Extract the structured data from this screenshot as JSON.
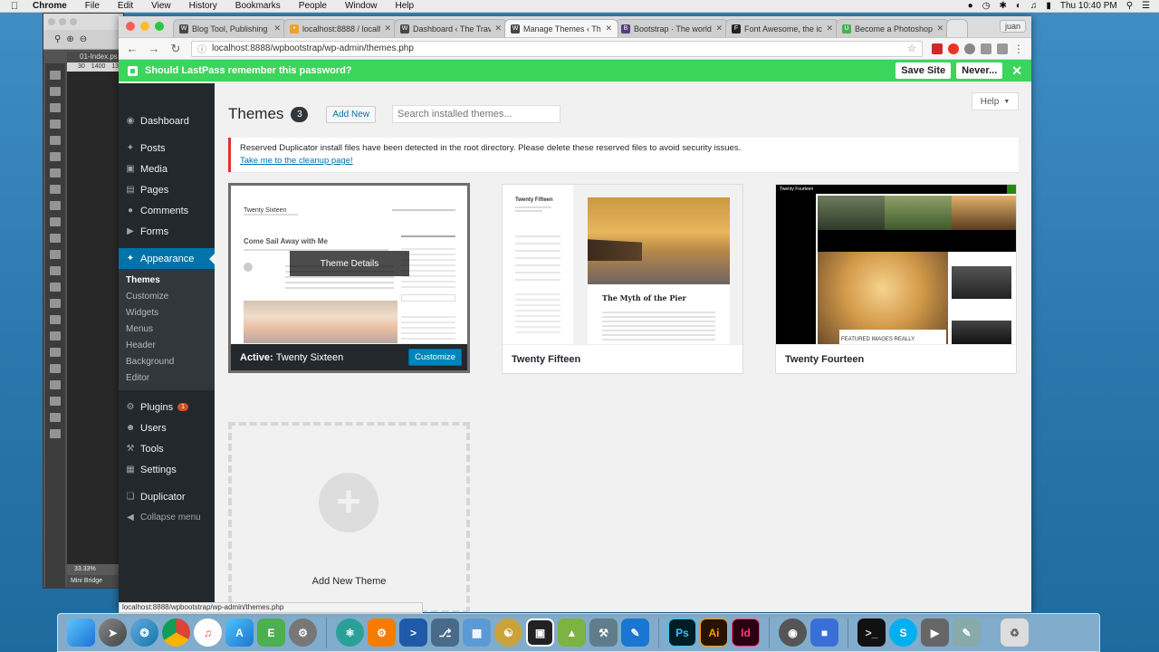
{
  "menubar": {
    "items": [
      "Chrome",
      "File",
      "Edit",
      "View",
      "History",
      "Bookmarks",
      "People",
      "Window",
      "Help"
    ],
    "clock": "Thu 10:40 PM"
  },
  "photoshop": {
    "doc_tab": "01-Index.ps",
    "ruler": [
      "30",
      "1400",
      "13"
    ],
    "zoom": "33.33%",
    "bridge": "Mini Bridge"
  },
  "browser": {
    "tabs": [
      {
        "title": "Blog Tool, Publishing Pl",
        "color": "#464646",
        "icon": "W"
      },
      {
        "title": "localhost:8888 / localhc",
        "color": "#f0a030",
        "icon": "•"
      },
      {
        "title": "Dashboard ‹ The Travel",
        "color": "#464646",
        "icon": "W"
      },
      {
        "title": "Manage Themes ‹ The T",
        "color": "#464646",
        "icon": "W"
      },
      {
        "title": "Bootstrap · The world's",
        "color": "#563d7c",
        "icon": "B"
      },
      {
        "title": "Font Awesome, the icon",
        "color": "#222222",
        "icon": "F"
      },
      {
        "title": "Become a Photoshop to",
        "color": "#4caf50",
        "icon": "U"
      }
    ],
    "user": "juan",
    "url": "localhost:8888/wpbootstrap/wp-admin/themes.php"
  },
  "lastpass": {
    "message": "Should LastPass remember this password?",
    "save": "Save Site",
    "never": "Never..."
  },
  "admin_menu": {
    "dashboard": "Dashboard",
    "posts": "Posts",
    "media": "Media",
    "pages": "Pages",
    "comments": "Comments",
    "forms": "Forms",
    "appearance": "Appearance",
    "submenu": [
      "Themes",
      "Customize",
      "Widgets",
      "Menus",
      "Header",
      "Background",
      "Editor"
    ],
    "plugins": "Plugins",
    "plugins_badge": "1",
    "users": "Users",
    "tools": "Tools",
    "settings": "Settings",
    "duplicator": "Duplicator",
    "collapse": "Collapse menu"
  },
  "page": {
    "help": "Help",
    "title": "Themes",
    "count": "3",
    "add_new": "Add New",
    "search_placeholder": "Search installed themes...",
    "notice": "Reserved Duplicator install files have been detected in the root directory. Please delete these reserved files to avoid security issues.",
    "notice_link": "Take me to the cleanup page!"
  },
  "themes": {
    "active_label": "Active:",
    "active_name": "Twenty Sixteen",
    "customize": "Customize",
    "details": "Theme Details",
    "fifteen": "Twenty Fifteen",
    "fourteen": "Twenty Fourteen",
    "add_new_theme": "Add New Theme"
  },
  "mock": {
    "sixteen_site": "Twenty Sixteen",
    "sixteen_post": "Come Sail Away with Me",
    "fifteen_site": "Twenty Fifteen",
    "fifteen_post": "The Myth of the Pier",
    "fourteen_site": "Twenty Fourteen",
    "fourteen_featured": "FEATURED IMAGES REALLY"
  },
  "status_url": "localhost:8888/wpbootstrap/wp-admin/themes.php",
  "colors": {
    "wp_blue": "#0073aa",
    "admin_dark": "#23282d",
    "lastpass_green": "#3bd55b",
    "notice_red": "#dc3232"
  }
}
